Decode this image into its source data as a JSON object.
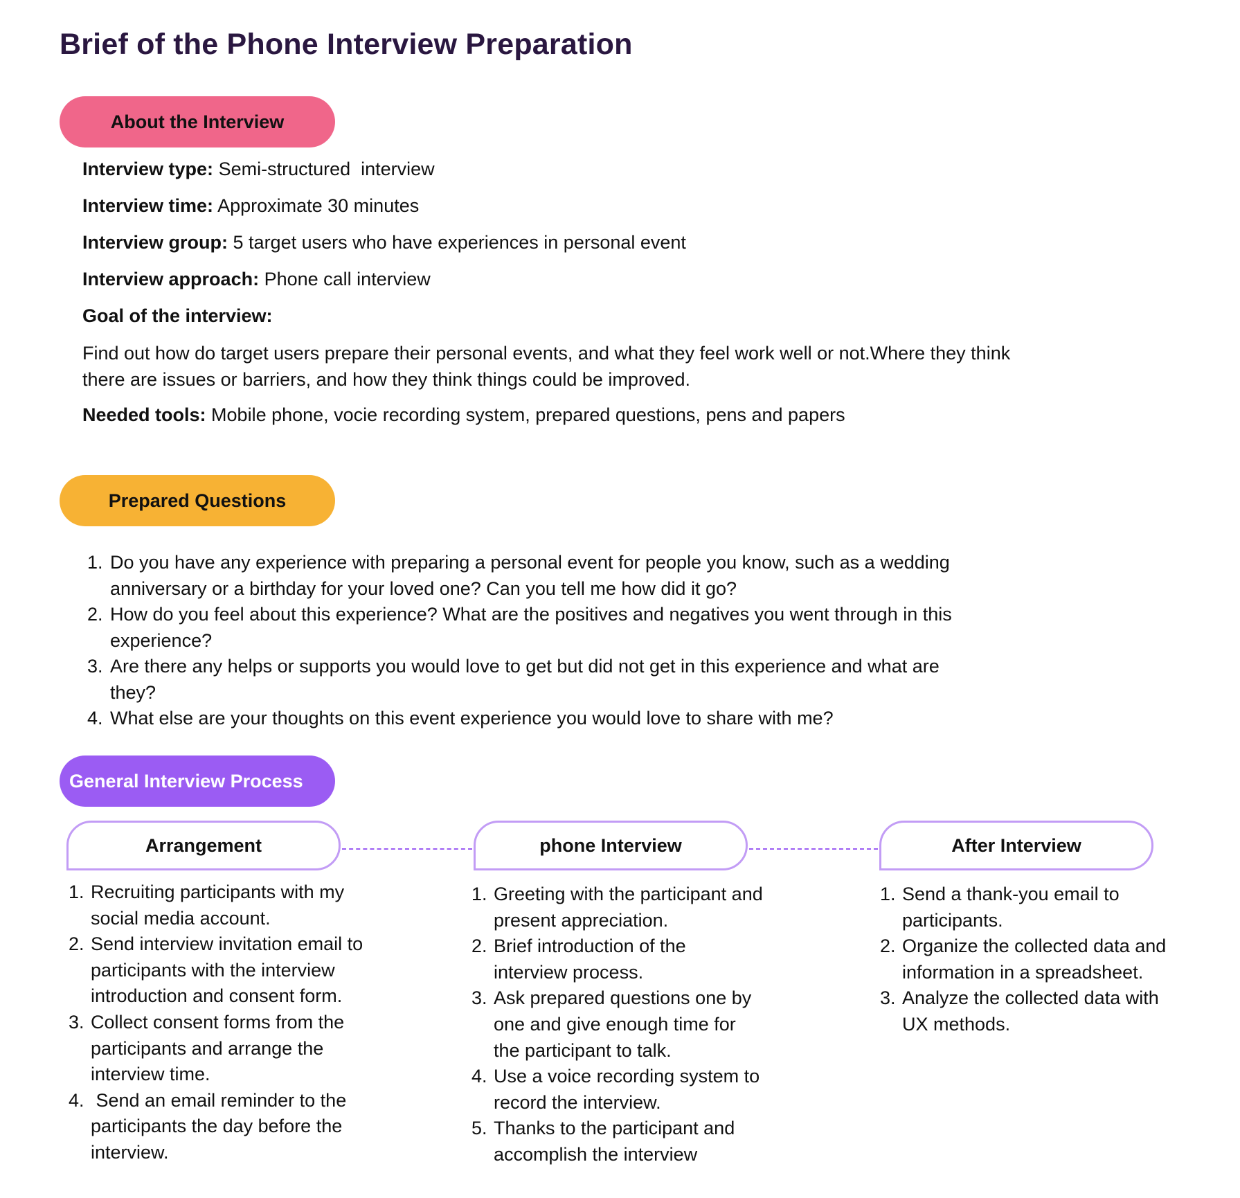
{
  "title": "Brief of the Phone Interview Preparation",
  "sections": {
    "about": {
      "label": "About the Interview",
      "colors": {
        "pill": "#f0668a"
      },
      "type_label": "Interview type:",
      "type_value": "Semi-structured  interview",
      "time_label": "Interview time:",
      "time_value": "Approximate 30 minutes",
      "group_label": "Interview group:",
      "group_value": "5 target users who have experiences in personal event",
      "approach_label": "Interview approach:",
      "approach_value": "Phone call interview",
      "goal_label": "Goal of the interview:",
      "goal_line1": "Find out how do target users prepare their personal events, and what they feel work well or not.Where they think",
      "goal_line2": "there are issues or barriers, and how they think things could be improved.",
      "tools_label": "Needed tools:",
      "tools_value": "Mobile phone, vocie recording system, prepared questions, pens and papers"
    },
    "questions": {
      "label": "Prepared Questions",
      "colors": {
        "pill": "#f7b234"
      },
      "items": [
        {
          "num": "1.",
          "line1": "Do you have any experience with preparing a personal event for people you know, such as a wedding",
          "line2": "anniversary or a birthday for your loved one? Can you tell me how did it go?"
        },
        {
          "num": "2.",
          "line1": "How do you feel about this experience? What are the positives and negatives you went through in this",
          "line2": "experience?"
        },
        {
          "num": "3.",
          "line1": "Are there any helps or supports you would love to get but did not get in this experience and what are",
          "line2": "they?"
        },
        {
          "num": "4.",
          "line1": "What else are your thoughts on this event experience you would love to share with me?"
        }
      ]
    },
    "process": {
      "label": "General Interview Process",
      "colors": {
        "pill": "#9b5cf3",
        "stage_border": "#c29cf5",
        "connector": "#9b5cf3"
      },
      "stages": [
        {
          "title": "Arrangement",
          "steps": [
            {
              "num": "1.",
              "lines": [
                "Recruiting participants with my",
                "social media account."
              ]
            },
            {
              "num": "2.",
              "lines": [
                "Send interview invitation email to",
                "participants with the interview",
                "introduction and consent form."
              ]
            },
            {
              "num": "3.",
              "lines": [
                "Collect consent forms from the",
                "participants and arrange the",
                "interview time."
              ]
            },
            {
              "num": "4.",
              "lines": [
                " Send an email reminder to the",
                "participants the day before the",
                "interview."
              ]
            }
          ]
        },
        {
          "title": "phone Interview",
          "steps": [
            {
              "num": "1.",
              "lines": [
                "Greeting with the participant and",
                "present appreciation."
              ]
            },
            {
              "num": "2.",
              "lines": [
                "Brief introduction of the",
                "interview process."
              ]
            },
            {
              "num": "3.",
              "lines": [
                "Ask prepared questions one by",
                "one and give enough time for",
                "the participant to talk."
              ]
            },
            {
              "num": "4.",
              "lines": [
                "Use a voice recording system to",
                "record the interview."
              ]
            },
            {
              "num": "5.",
              "lines": [
                "Thanks to the participant and",
                "accomplish the interview"
              ]
            }
          ]
        },
        {
          "title": "After Interview",
          "steps": [
            {
              "num": "1.",
              "lines": [
                "Send a thank-you email to",
                "participants."
              ]
            },
            {
              "num": "2.",
              "lines": [
                "Organize the collected data and",
                "information in a spreadsheet."
              ]
            },
            {
              "num": "3.",
              "lines": [
                "Analyze the collected data with",
                "UX methods."
              ]
            }
          ]
        }
      ]
    }
  }
}
